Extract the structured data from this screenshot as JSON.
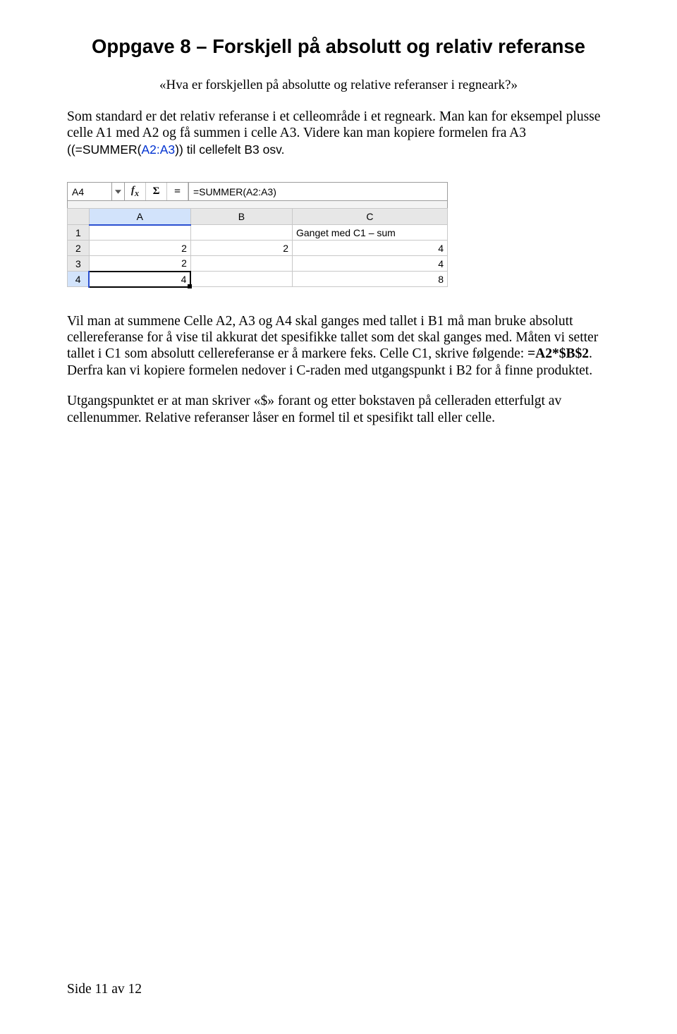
{
  "title": "Oppgave 8 – Forskjell på absolutt og relativ referanse",
  "subtitle": "«Hva er forskjellen på absolutte og relative referanser i regneark?»",
  "para1_a": "Som standard er det relativ referanse i et celleområde i et regneark. Man kan for eksempel plusse celle A1 med A2 og få summen i celle A3. Videre kan man kopiere formelen fra A3 ",
  "para1_b": "((=SUMMER(",
  "para1_c": "A2:A3",
  "para1_d": ")) til cellefelt B3 osv.",
  "spreadsheet": {
    "namebox": "A4",
    "formula_bar": "=SUMMER(A2:A3)",
    "columns": [
      "A",
      "B",
      "C"
    ],
    "rows": [
      {
        "n": "1",
        "a": "",
        "b": "",
        "c": "Ganget med C1 – sum",
        "ctext": true
      },
      {
        "n": "2",
        "a": "2",
        "b": "2",
        "c": "4"
      },
      {
        "n": "3",
        "a": "2",
        "b": "",
        "c": "4"
      },
      {
        "n": "4",
        "a": "4",
        "b": "",
        "c": "8",
        "active": true
      }
    ]
  },
  "para2": "Vil man at summene Celle A2, A3 og A4 skal ganges med tallet i B1 må man bruke absolutt cellereferanse for å vise til akkurat det spesifikke tallet som det skal ganges med. Måten vi setter tallet i C1 som absolutt cellereferanse er å markere feks. Celle C1, skrive følgende: ",
  "para2_bold": "=A2*$B$2",
  "para2_after": ". Derfra kan vi kopiere formelen nedover i C-raden med utgangspunkt i B2 for å finne produktet.",
  "para3": "Utgangspunktet er at man skriver «$» forant og etter bokstaven på celleraden etterfulgt av cellenummer. Relative referanser låser en formel til et spesifikt tall eller celle.",
  "footer": "Side 11 av 12"
}
